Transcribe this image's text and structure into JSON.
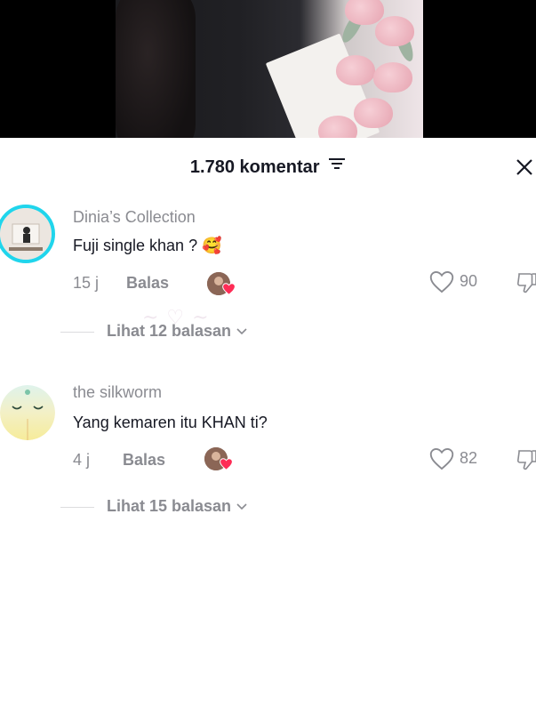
{
  "sheet": {
    "title": "1.780 komentar"
  },
  "comments": [
    {
      "username": "Dinia’s Collection",
      "text": "Fuji single khan ? 🥰",
      "time": "15 j",
      "reply_label": "Balas",
      "likes": "90",
      "view_replies": "Lihat 12 balasan"
    },
    {
      "username": "the silkworm",
      "text": "Yang kemaren itu KHAN ti?",
      "time": "4 j",
      "reply_label": "Balas",
      "likes": "82",
      "view_replies": "Lihat 15 balasan"
    }
  ],
  "colors": {
    "primary_text": "#161823",
    "secondary_text": "#8a8b91",
    "like_heart_creator": "#fe2c55",
    "avatar_ring": "#20d5ec"
  },
  "icons": [
    "filter-icon",
    "close-icon",
    "heart-outline-icon",
    "dislike-icon",
    "chevron-down-icon"
  ]
}
